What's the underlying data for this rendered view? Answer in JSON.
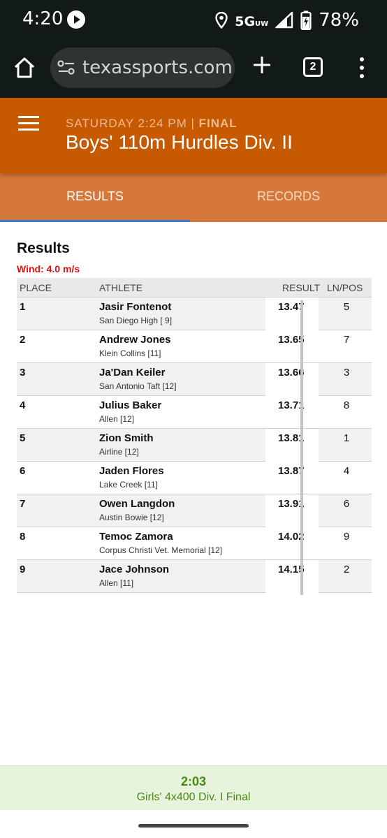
{
  "status_bar": {
    "time": "4:20",
    "network": "5G",
    "network_sub": "UW",
    "battery": "78%"
  },
  "browser": {
    "url": "texassports.com",
    "tab_count": "2"
  },
  "event": {
    "meta_prefix": "SATURDAY 2:24 PM | ",
    "meta_status": "FINAL",
    "title": "Boys' 110m Hurdles Div. II"
  },
  "tabs": [
    {
      "label": "RESULTS",
      "active": true
    },
    {
      "label": "RECORDS",
      "active": false
    }
  ],
  "results": {
    "heading": "Results",
    "wind": "Wind: 4.0 m/s",
    "columns": {
      "place": "PLACE",
      "athlete": "ATHLETE",
      "result": "RESULT",
      "lane": "LN/POS"
    },
    "rows": [
      {
        "place": "1",
        "name": "Jasir Fontenot",
        "school": "San Diego High [ 9]",
        "result": "13.47",
        "lane": "5"
      },
      {
        "place": "2",
        "name": "Andrew Jones",
        "school": "Klein Collins [11]",
        "result": "13.65",
        "lane": "7"
      },
      {
        "place": "3",
        "name": "Ja'Dan Keiler",
        "school": "San Antonio Taft [12]",
        "result": "13.66",
        "lane": "3"
      },
      {
        "place": "4",
        "name": "Julius Baker",
        "school": "Allen [12]",
        "result": "13.71",
        "lane": "8"
      },
      {
        "place": "5",
        "name": "Zion Smith",
        "school": "Airline [12]",
        "result": "13.81",
        "lane": "1"
      },
      {
        "place": "6",
        "name": "Jaden Flores",
        "school": "Lake Creek [11]",
        "result": "13.87",
        "lane": "4"
      },
      {
        "place": "7",
        "name": "Owen Langdon",
        "school": "Austin Bowie [12]",
        "result": "13.91",
        "lane": "6"
      },
      {
        "place": "8",
        "name": "Temoc Zamora",
        "school": "Corpus Christi Vet. Memorial [12]",
        "result": "14.02",
        "lane": "9"
      },
      {
        "place": "9",
        "name": "Jace Johnson",
        "school": "Allen [11]",
        "result": "14.15",
        "lane": "2"
      }
    ]
  },
  "next_event": {
    "time": "2:03",
    "name": "Girls' 4x400 Div. I Final"
  },
  "colors": {
    "header_orange": "#c75a00",
    "tab_orange": "#d5783a",
    "wind_red": "#e01010",
    "next_green": "#4a8a12"
  },
  "icons": [
    "play-icon",
    "location-icon",
    "signal-icon",
    "battery-icon",
    "home-icon",
    "site-settings-icon",
    "plus-icon",
    "tab-switcher-icon",
    "more-vert-icon",
    "menu-icon"
  ]
}
